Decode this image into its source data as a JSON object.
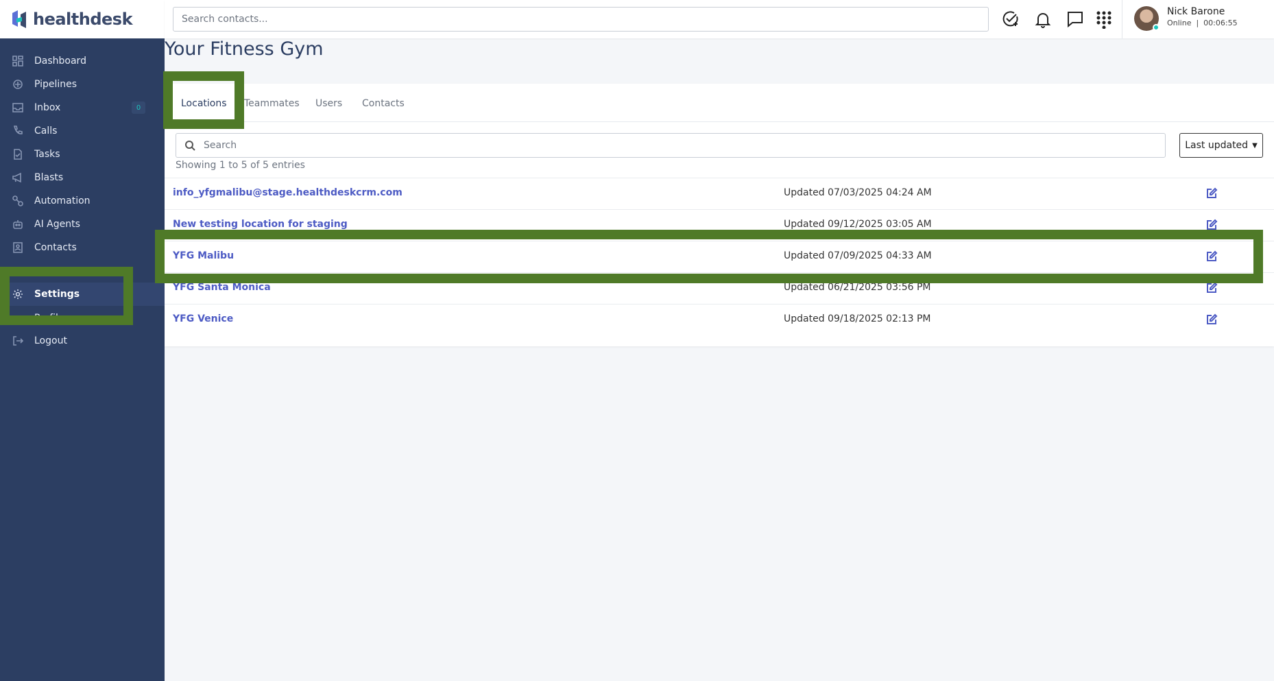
{
  "app": {
    "brand": "healthdesk"
  },
  "topbar": {
    "search_placeholder": "Search contacts...",
    "user_name": "Nick Barone",
    "user_status": "Online  |  00:06:55"
  },
  "sidebar": {
    "items": [
      {
        "label": "Dashboard",
        "icon": "dashboard-icon"
      },
      {
        "label": "Pipelines",
        "icon": "pipelines-icon"
      },
      {
        "label": "Inbox",
        "icon": "inbox-icon",
        "badge": "0"
      },
      {
        "label": "Calls",
        "icon": "phone-icon"
      },
      {
        "label": "Tasks",
        "icon": "tasks-icon"
      },
      {
        "label": "Blasts",
        "icon": "megaphone-icon"
      },
      {
        "label": "Automation",
        "icon": "automation-icon"
      },
      {
        "label": "AI Agents",
        "icon": "robot-icon"
      },
      {
        "label": "Contacts",
        "icon": "contacts-icon"
      },
      {
        "label": "Settings",
        "icon": "gear-icon",
        "active": true
      },
      {
        "label": "Logout",
        "icon": "logout-icon"
      }
    ],
    "hidden_item": "Profile"
  },
  "page": {
    "title": "Your Fitness Gym"
  },
  "tabs": [
    "Locations",
    "Teammates",
    "Users",
    "Contacts"
  ],
  "list": {
    "search_placeholder": "Search",
    "sort_label": "Last updated",
    "entries_text": "Showing 1 to 5 of 5 entries",
    "rows": [
      {
        "name": "info_yfgmalibu@stage.healthdeskcrm.com",
        "updated": "Updated 07/03/2025 04:24 AM"
      },
      {
        "name": "New testing location for staging",
        "updated": "Updated 09/12/2025 03:05 AM"
      },
      {
        "name": "YFG Malibu",
        "updated": "Updated 07/09/2025 04:33 AM"
      },
      {
        "name": "YFG Santa Monica",
        "updated": "Updated 06/21/2025 03:56 PM"
      },
      {
        "name": "YFG Venice",
        "updated": "Updated 09/18/2025 02:13 PM"
      }
    ]
  },
  "colors": {
    "sidebar": "#2c3e62",
    "link": "#4d5bc4",
    "highlight": "#4f7a28"
  }
}
